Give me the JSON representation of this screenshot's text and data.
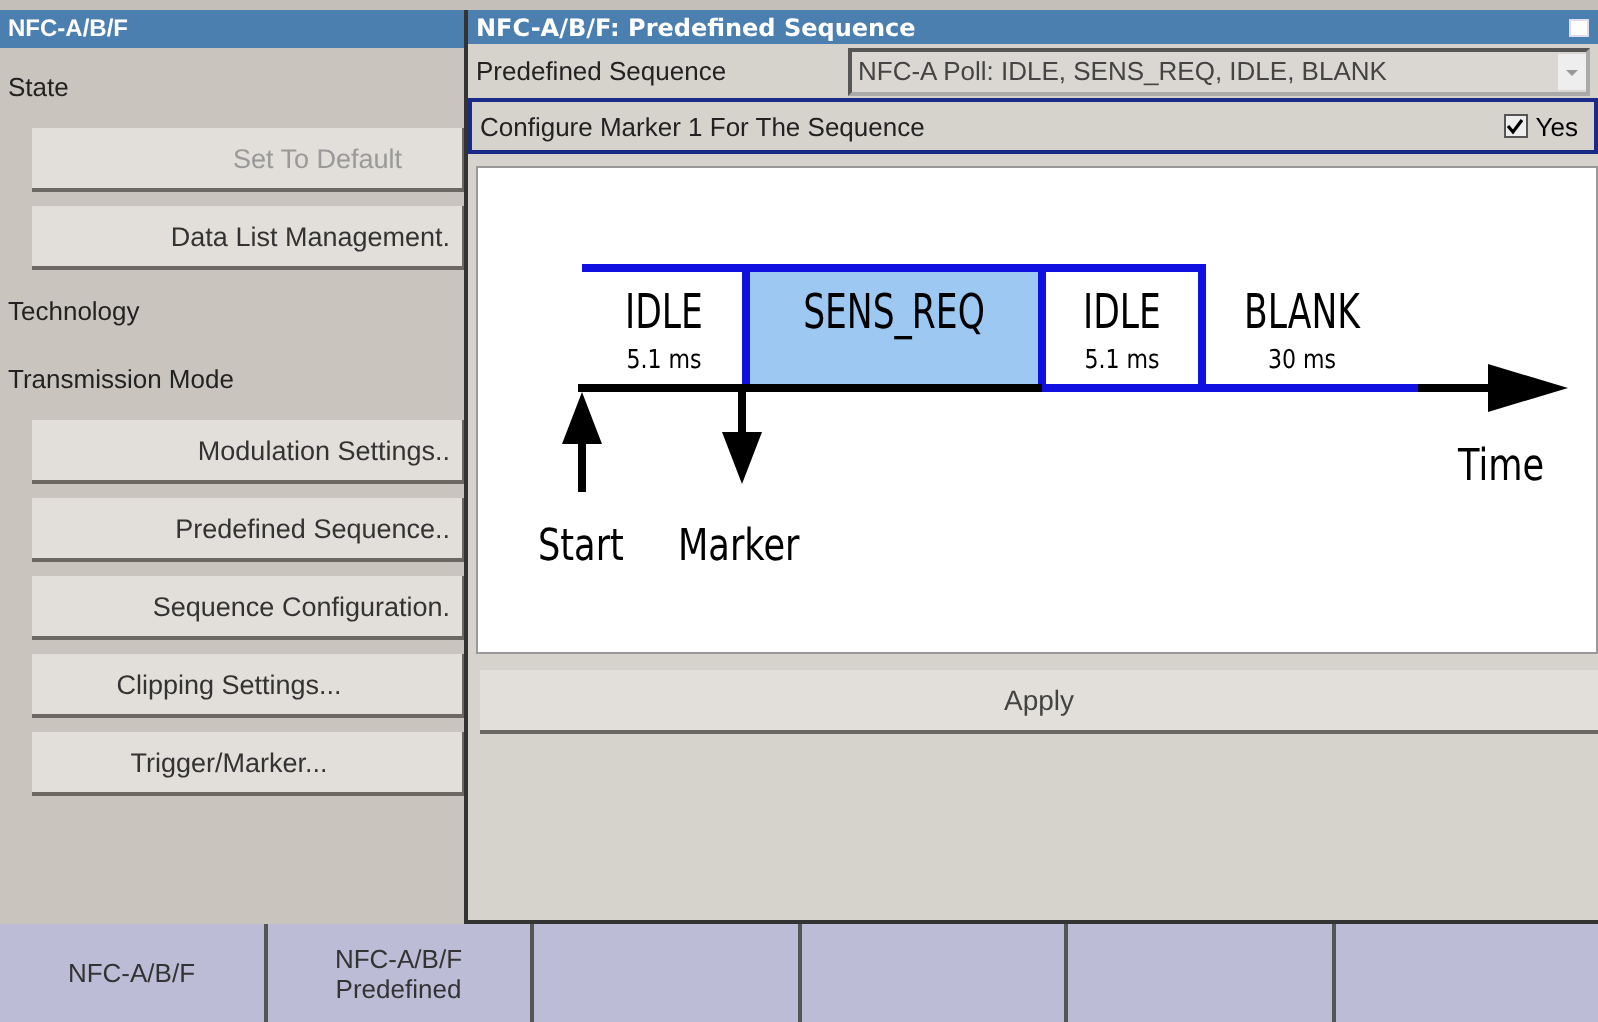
{
  "panel": {
    "title": "NFC-A/B/F",
    "items": [
      {
        "kind": "label",
        "text": "State"
      },
      {
        "kind": "button",
        "text": "Set To Default",
        "disabled": true
      },
      {
        "kind": "button",
        "text": "Data List Management.",
        "disabled": false
      },
      {
        "kind": "label",
        "text": "Technology"
      },
      {
        "kind": "label",
        "text": "Transmission Mode"
      },
      {
        "kind": "button",
        "text": "Modulation Settings..",
        "disabled": false
      },
      {
        "kind": "button",
        "text": "Predefined Sequence..",
        "disabled": false
      },
      {
        "kind": "button",
        "text": "Sequence Configuration.",
        "disabled": false
      },
      {
        "kind": "button",
        "text": "Clipping Settings...",
        "disabled": false
      },
      {
        "kind": "button",
        "text": "Trigger/Marker...",
        "disabled": false
      }
    ]
  },
  "dialog": {
    "title": "NFC-A/B/F: Predefined Sequence",
    "sequence": {
      "label": "Predefined Sequence",
      "value": "NFC-A Poll: IDLE, SENS_REQ, IDLE, BLANK"
    },
    "marker": {
      "label": "Configure Marker 1 For The Sequence",
      "checked": true,
      "option": "Yes"
    },
    "diagram": {
      "segments": [
        {
          "kind": "open",
          "label": "IDLE",
          "duration": "5.1 ms"
        },
        {
          "kind": "filled",
          "label": "SENS_REQ"
        },
        {
          "kind": "boxed",
          "label": "IDLE",
          "duration": "5.1 ms"
        },
        {
          "kind": "plain",
          "label": "BLANK",
          "duration": "30 ms"
        }
      ],
      "axis_label": "Time",
      "start_label": "Start",
      "marker_label": "Marker"
    },
    "apply": "Apply"
  },
  "softkeys": [
    {
      "lines": [
        "NFC-A/B/F"
      ]
    },
    {
      "lines": [
        "NFC-A/B/F",
        "Predefined"
      ]
    }
  ]
}
